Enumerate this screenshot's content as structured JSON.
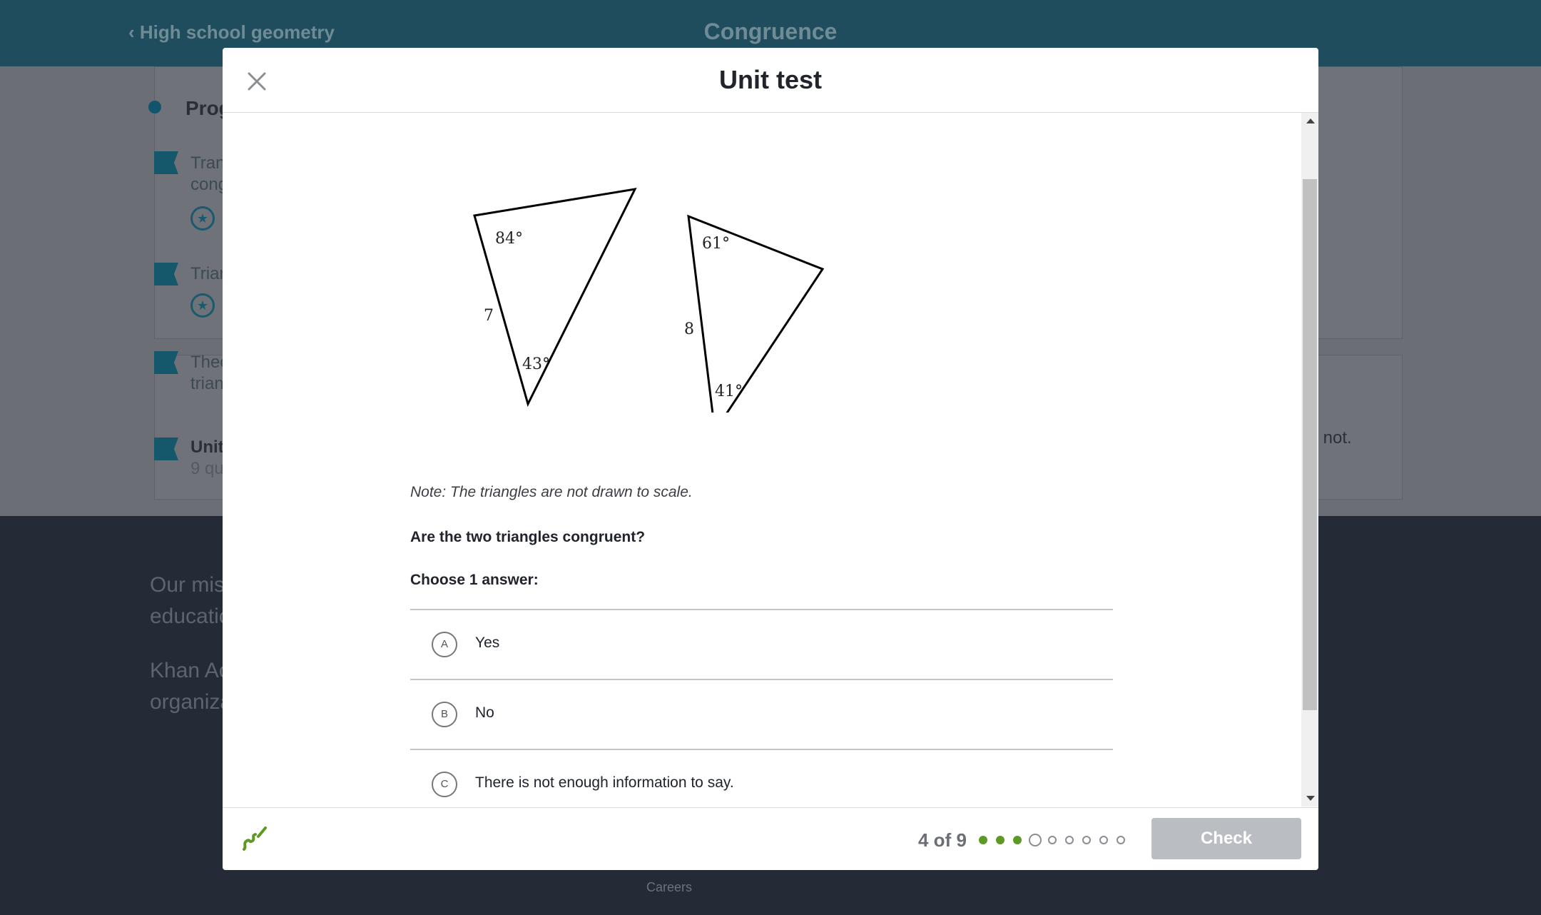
{
  "background": {
    "back_link": "High school geometry",
    "page_title": "Congruence",
    "progress_label": "Prog",
    "items": [
      {
        "line1": "Tran",
        "line2": "cong"
      },
      {
        "line1": "Trian",
        "line2": ""
      },
      {
        "line1": "Theo",
        "line2": "trian"
      },
      {
        "line1": "Unit",
        "line2": "9 qu"
      }
    ],
    "right_fragment": "r not.",
    "mission_line1": "Our mis",
    "mission_line2": "educatio",
    "khan_line1": "Khan Ac",
    "khan_line2": "organiza",
    "careers": "Careers"
  },
  "modal": {
    "title": "Unit test",
    "figure": {
      "triangle1": {
        "angle_top": "84°",
        "side_left": "7",
        "angle_bottom": "43°"
      },
      "triangle2": {
        "angle_top": "61°",
        "side_left": "8",
        "angle_bottom": "41°"
      }
    },
    "note": "Note: The triangles are not drawn to scale.",
    "question": "Are the two triangles congruent?",
    "prompt": "Choose 1 answer:",
    "choices": [
      {
        "letter": "A",
        "text": "Yes"
      },
      {
        "letter": "B",
        "text": "No"
      },
      {
        "letter": "C",
        "text": "There is not enough information to say."
      }
    ],
    "footer": {
      "progress": "4 of 9",
      "current_question": 4,
      "total_questions": 9,
      "completed": 3,
      "check_label": "Check"
    }
  },
  "colors": {
    "topbar": "#1f4d5e",
    "accent_green": "#5c9a23",
    "check_disabled": "#babec2"
  },
  "icons": {
    "close": "close-icon",
    "hint": "scratchpad-pencil-icon",
    "back": "chevron-left-icon",
    "badge": "star-badge-icon"
  }
}
